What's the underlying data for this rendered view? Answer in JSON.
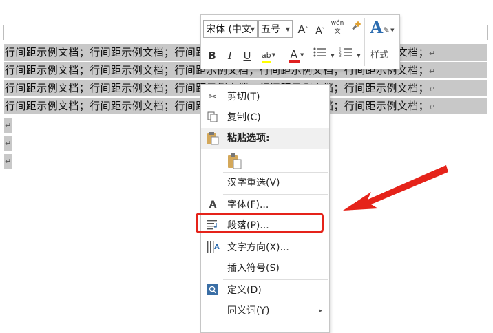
{
  "document": {
    "lines": [
      "行间距示例文档；行间距示例文档；行间距示例文档；行间距示例文档；行间距示例文档；",
      "行间距示例文档；行间距示例文档；行间距示例文档；行间距示例文档；行间距示例文档；",
      "行间距示例文档；行间距示例文档；行间距示例文档；行间距示例文档；行间距示例文档；",
      "行间距示例文档；行间距示例文档；行间距示例文档；行间距示例文档；行间距示例文档；"
    ],
    "paragraph_mark": "↵",
    "selection_color": "#c8c8c8"
  },
  "mini_toolbar": {
    "font_name": "宋体 (中文",
    "font_size": "五号",
    "grow_font": "A",
    "shrink_font": "A",
    "phonetic": "wén 文",
    "bold": "B",
    "italic": "I",
    "underline": "U",
    "font_color": "A",
    "styles_label": "样式",
    "font_color_hex": "#e02020",
    "highlight_color_hex": "#ffff00",
    "styles_icon": "styles-icon"
  },
  "context_menu": {
    "items": [
      {
        "label": "剪切(T)",
        "icon": "scissors-icon"
      },
      {
        "label": "复制(C)",
        "icon": "copy-icon"
      },
      {
        "label": "粘贴选项:",
        "icon": "paste-icon"
      },
      {
        "label": "",
        "icon": "paste-keep-text-icon"
      },
      {
        "label": "汉字重选(V)",
        "icon": ""
      },
      {
        "label": "字体(F)...",
        "icon": "font-icon"
      },
      {
        "label": "段落(P)...",
        "icon": "paragraph-icon"
      },
      {
        "label": "文字方向(X)...",
        "icon": "text-direction-icon"
      },
      {
        "label": "插入符号(S)",
        "icon": ""
      },
      {
        "label": "定义(D)",
        "icon": "define-icon"
      },
      {
        "label": "同义词(Y)",
        "icon": "",
        "submenu": "▸"
      }
    ]
  },
  "annotation": {
    "highlight_color": "#e5231a",
    "target": "段落(P)..."
  }
}
